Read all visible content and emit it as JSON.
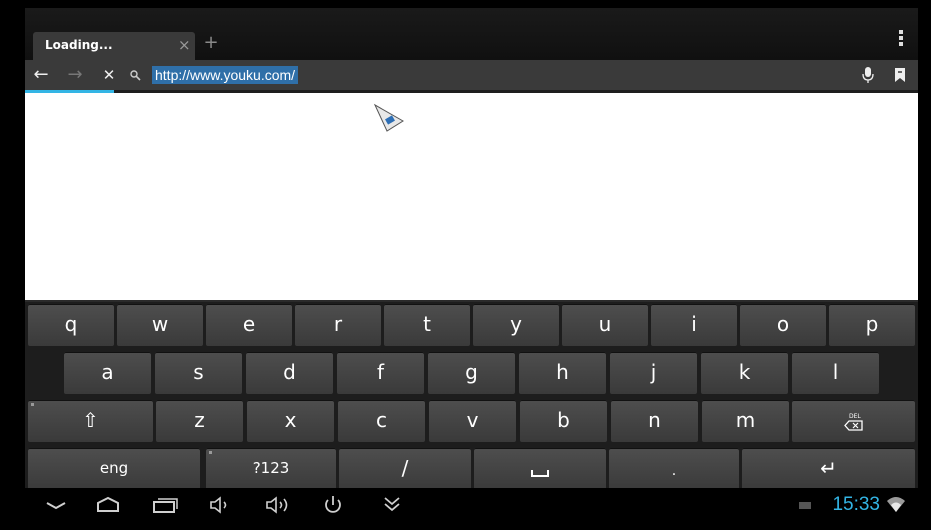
{
  "browser": {
    "tab_title": "Loading...",
    "tab_close": "×",
    "new_tab": "+",
    "url": "http://www.youku.com/",
    "back_arrow": "←",
    "forward_arrow": "→",
    "stop": "✕",
    "progress_fraction": 0.1
  },
  "keyboard": {
    "row1": [
      "q",
      "w",
      "e",
      "r",
      "t",
      "y",
      "u",
      "i",
      "o",
      "p"
    ],
    "row2": [
      "a",
      "s",
      "d",
      "f",
      "g",
      "h",
      "j",
      "k",
      "l"
    ],
    "row3": [
      "⇧",
      "z",
      "x",
      "c",
      "v",
      "b",
      "n",
      "m",
      "DEL"
    ],
    "row4": [
      "eng",
      "?123",
      "/",
      "␣",
      ".",
      "↵"
    ]
  },
  "status": {
    "time": "15:33"
  },
  "colors": {
    "accent": "#33b5e5",
    "url_highlight": "#2f6fa8"
  }
}
